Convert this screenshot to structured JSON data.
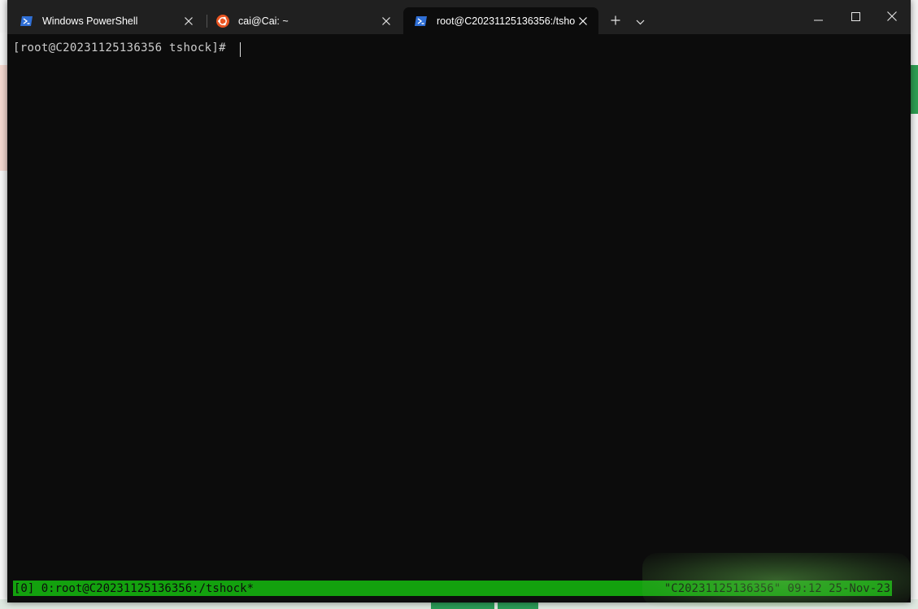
{
  "tabs": [
    {
      "label": "Windows PowerShell",
      "icon": "powershell-icon",
      "active": false
    },
    {
      "label": "cai@Cai: ~",
      "icon": "ubuntu-icon",
      "active": false
    },
    {
      "label": "root@C20231125136356:/tsho",
      "icon": "powershell-icon",
      "active": true
    }
  ],
  "terminal": {
    "prompt": "[root@C20231125136356 tshock]# "
  },
  "tmux": {
    "left": "[0] 0:root@C20231125136356:/tshock*",
    "right": "\"C20231125136356\" 09:12 25-Nov-23"
  },
  "colors": {
    "terminal_bg": "#0c0c0c",
    "titlebar_bg": "#202020",
    "tmux_bar": "#13a10e",
    "powershell_icon": "#2f6fd6",
    "ubuntu_icon": "#e95420"
  }
}
